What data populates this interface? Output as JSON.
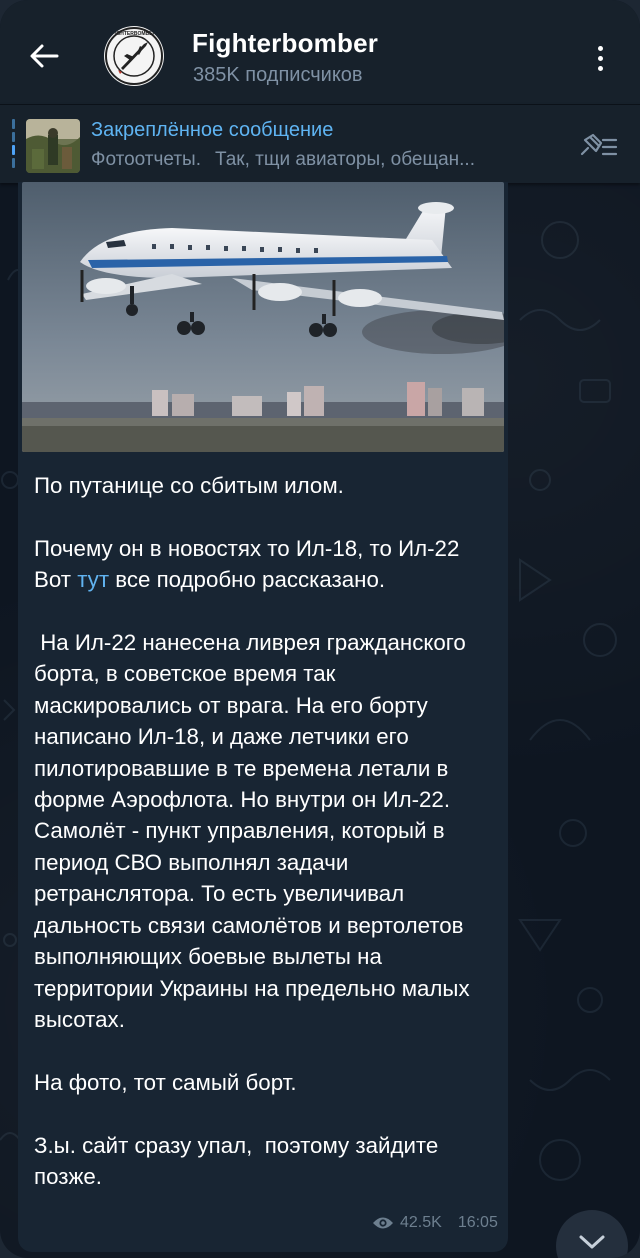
{
  "header": {
    "channel_name": "Fighterbomber",
    "subscribers": "385K подписчиков"
  },
  "pinned": {
    "title": "Закреплённое сообщение",
    "preview_part1": "Фотоотчеты.",
    "preview_part2": "Так, тщи авиаторы, обещан..."
  },
  "message": {
    "p1": "По путанице со сбитым илом.",
    "p2a": "Почему он в новостях то Ил-18, то Ил-22",
    "p2b_before": "Вот ",
    "p2b_link": "тут",
    "p2b_after": " все подробно рассказано.",
    "p3": " На Ил-22 нанесена ливрея гражданского борта, в советское время так маскировались от врага. На его борту написано Ил-18, и даже летчики его пилотировавшие в те времена летали в форме Аэрофлота. Но внутри он Ил-22. Самолёт - пункт управления, который в период СВО выполнял задачи ретранслятора. То есть увеличивал дальность связи самолётов и вертолетов выполняющих боевые вылеты на территории Украины на предельно малых высотах.",
    "p4": "На фото, тот самый борт.",
    "p5": "З.ы. сайт сразу упал,  поэтому зайдите позже.",
    "views": "42.5K",
    "time": "16:05"
  },
  "icons": {
    "back": "arrow-left-icon",
    "menu": "more-vertical-icon",
    "pin_list": "pin-list-icon",
    "views": "eye-icon",
    "scroll": "chevron-down-icon"
  },
  "colors": {
    "accent": "#5fb4f2",
    "link": "#61b3f0",
    "bubble": "#182533",
    "header": "#17212b",
    "background": "#0e1621"
  }
}
